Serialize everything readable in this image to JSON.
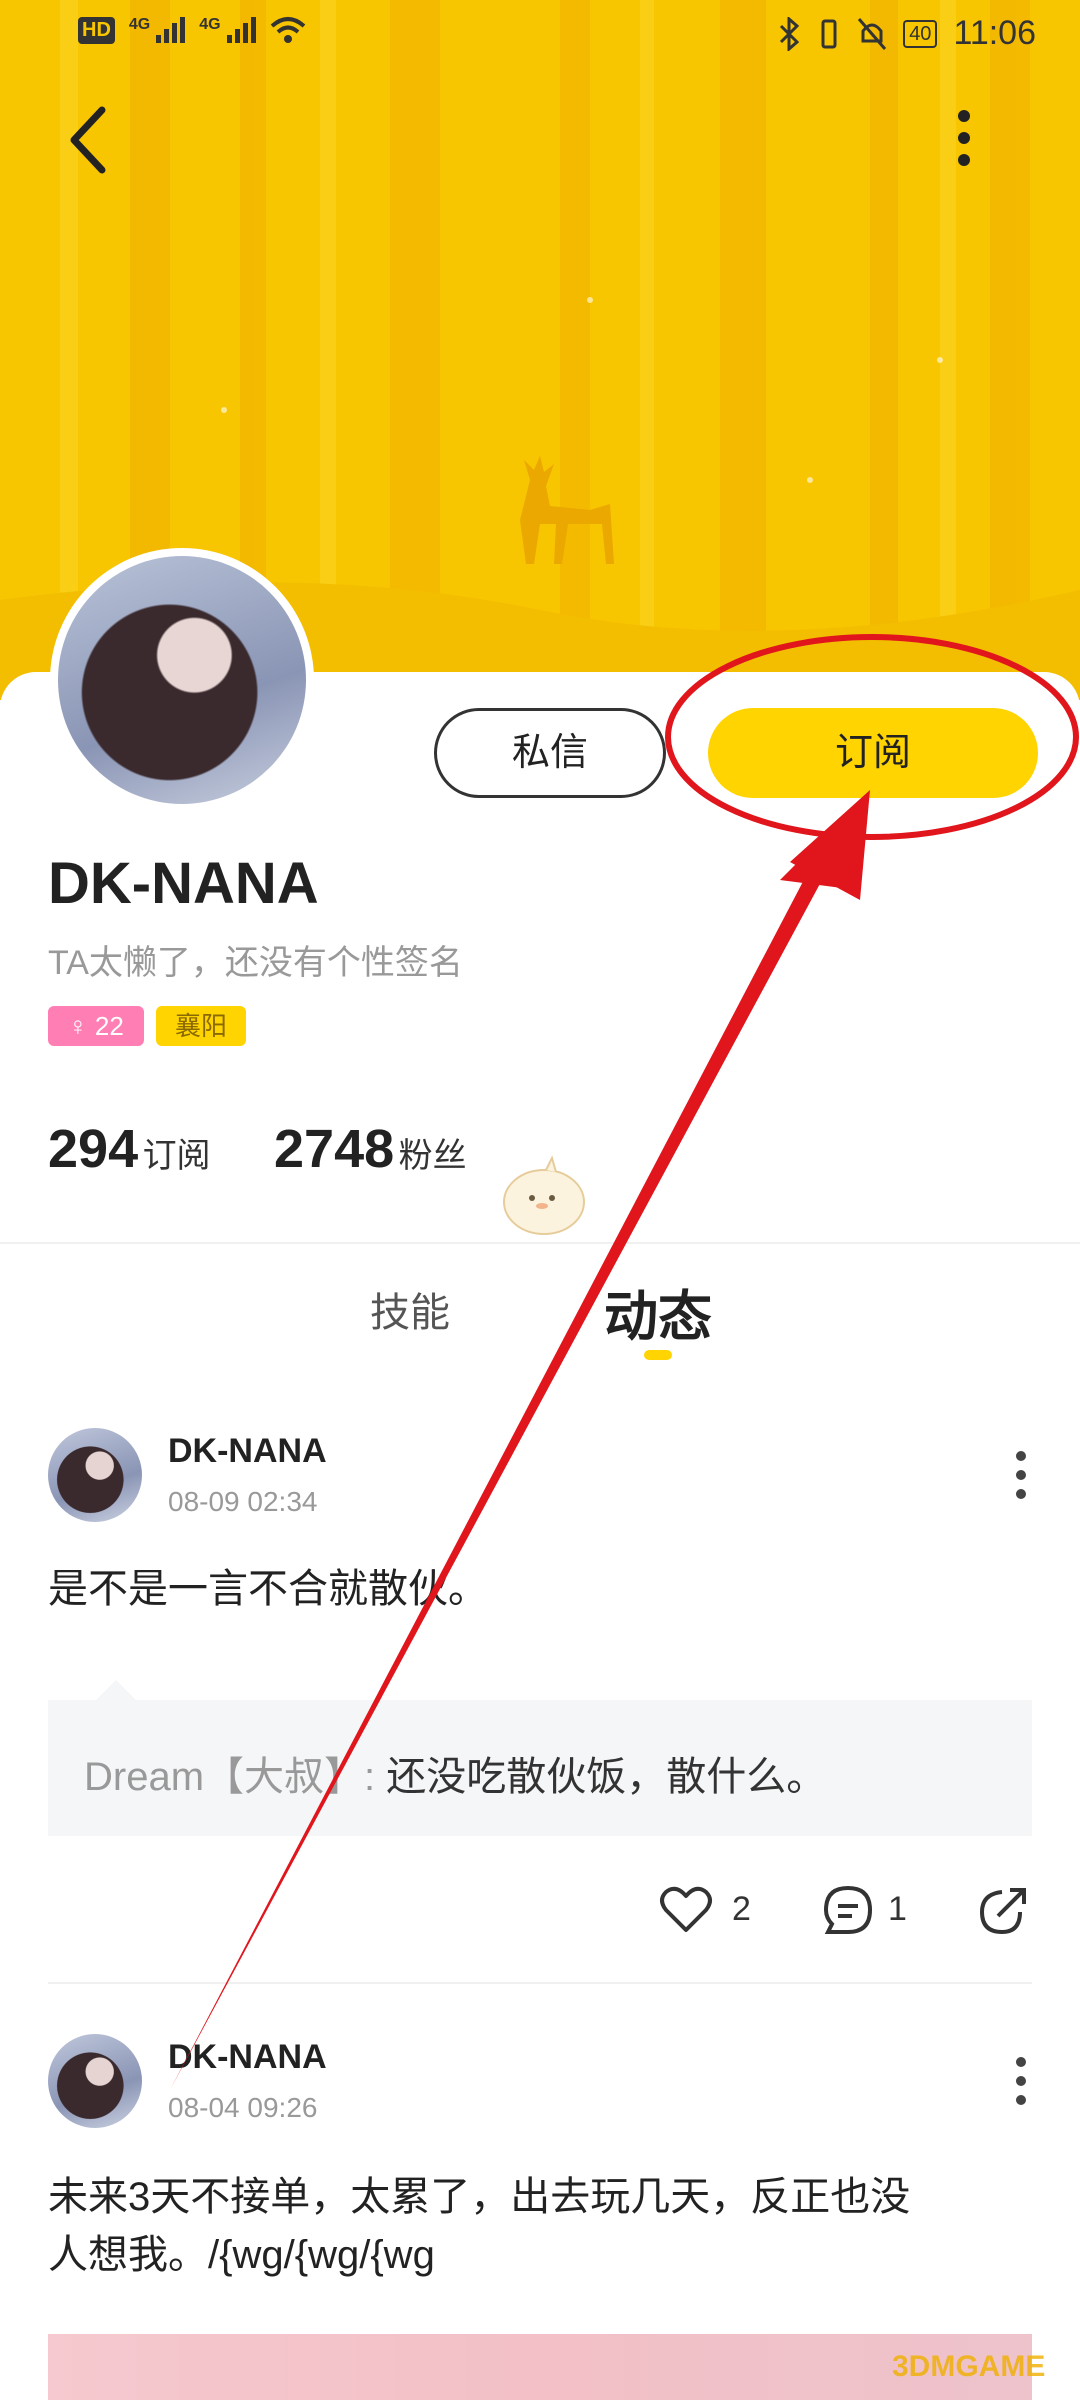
{
  "status_bar": {
    "hd_label": "HD",
    "sim1": "4G",
    "sim2": "4G",
    "battery": "40",
    "time": "11:06"
  },
  "profile": {
    "name": "DK-NANA",
    "signature": "TA太懒了，还没有个性签名",
    "age_tag": "♀ 22",
    "city_tag": "襄阳",
    "message_button": "私信",
    "subscribe_button": "订阅",
    "subscriptions_count": "294",
    "subscriptions_label": "订阅",
    "fans_count": "2748",
    "fans_label": "粉丝"
  },
  "tabs": [
    {
      "label": "技能",
      "active": false
    },
    {
      "label": "动态",
      "active": true
    }
  ],
  "posts": [
    {
      "author": "DK-NANA",
      "time": "08-09 02:34",
      "text": "是不是一言不合就散伙。",
      "reply_user": "Dream【大叔】:",
      "reply_text": "还没吃散伙饭，散什么。",
      "likes": "2",
      "comments": "1"
    },
    {
      "author": "DK-NANA",
      "time": "08-04 09:26",
      "text_line1": "未来3天不接单，太累了，出去玩几天，反正也没",
      "text_line2": "人想我。/{wg/{wg/{wg"
    }
  ],
  "watermark": "3DMGAME",
  "colors": {
    "accent_yellow": "#ffd400",
    "banner_yellow": "#f7c600",
    "annotation_red": "#e0161c",
    "gender_pink": "#ff7fb5"
  }
}
